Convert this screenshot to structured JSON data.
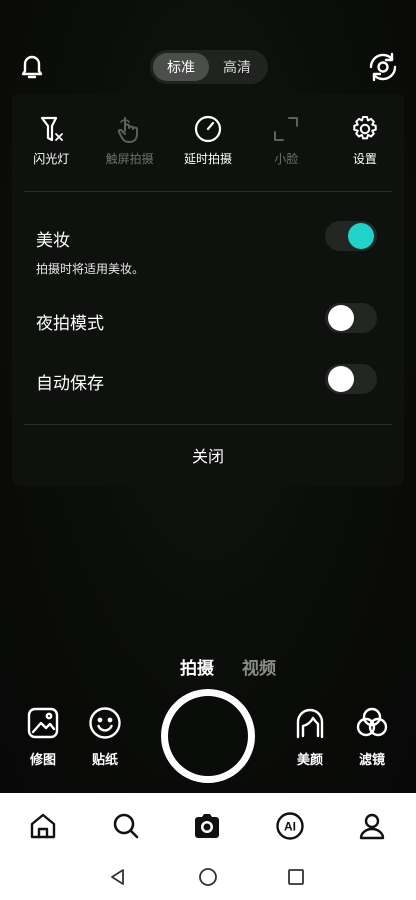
{
  "top_bar": {
    "quality_options": [
      "标准",
      "高清"
    ],
    "quality_selected": "标准"
  },
  "panel": {
    "tools": [
      {
        "label": "闪光灯",
        "icon": "flash-off-icon",
        "enabled": true
      },
      {
        "label": "触屏拍摄",
        "icon": "touch-hand-icon",
        "enabled": false
      },
      {
        "label": "延时拍摄",
        "icon": "timer-icon",
        "enabled": true
      },
      {
        "label": "小脸",
        "icon": "face-frame-icon",
        "enabled": false
      },
      {
        "label": "设置",
        "icon": "gear-icon",
        "enabled": true
      }
    ],
    "makeup": {
      "label": "美妆",
      "description": "拍摄时将适用美妆。",
      "on": true
    },
    "night_mode": {
      "label": "夜拍模式",
      "on": false
    },
    "auto_save": {
      "label": "自动保存",
      "on": false
    },
    "close_label": "关闭"
  },
  "mode_tabs": {
    "photo": "拍摄",
    "video": "视频"
  },
  "controls": {
    "edit": "修图",
    "sticker": "贴纸",
    "beauty": "美颜",
    "filter": "滤镜"
  },
  "colors": {
    "accent": "#1fd3c8"
  }
}
